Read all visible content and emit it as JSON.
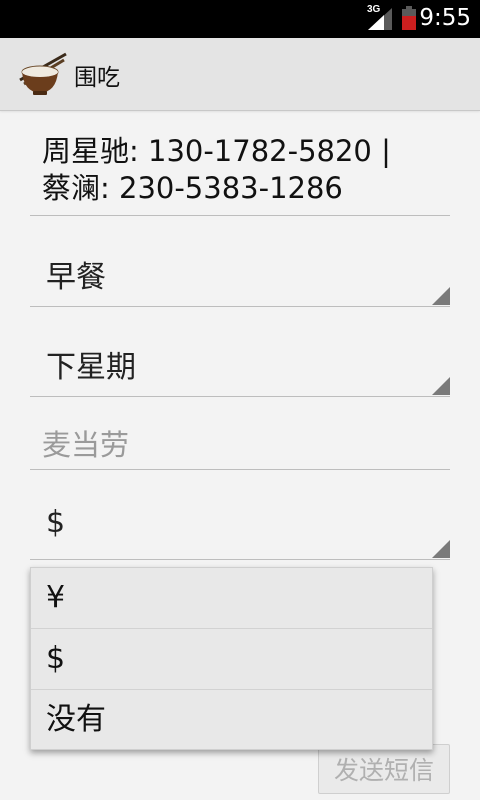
{
  "status_bar": {
    "network": "3G",
    "time": "9:55"
  },
  "app": {
    "title": "围吃",
    "icon": "rice-bowl-icon"
  },
  "form": {
    "contacts_line1": "周星驰: 130-1782-5820 |",
    "contacts_line2": "蔡澜: 230-5383-1286",
    "meal_spinner": {
      "selected": "早餐"
    },
    "time_spinner": {
      "selected": "下星期"
    },
    "restaurant_input": {
      "value": "",
      "placeholder": "麦当劳"
    },
    "currency_spinner": {
      "selected": "$"
    },
    "send_button": "发送短信"
  },
  "currency_dropdown": {
    "options": [
      "¥",
      "$",
      "没有"
    ]
  },
  "colors": {
    "status_bar_bg": "#000000",
    "action_bar_bg": "#e4e4e4",
    "page_bg": "#f3f3f3",
    "divider": "#bdbdbd",
    "disabled_text": "#b0b0b0"
  }
}
